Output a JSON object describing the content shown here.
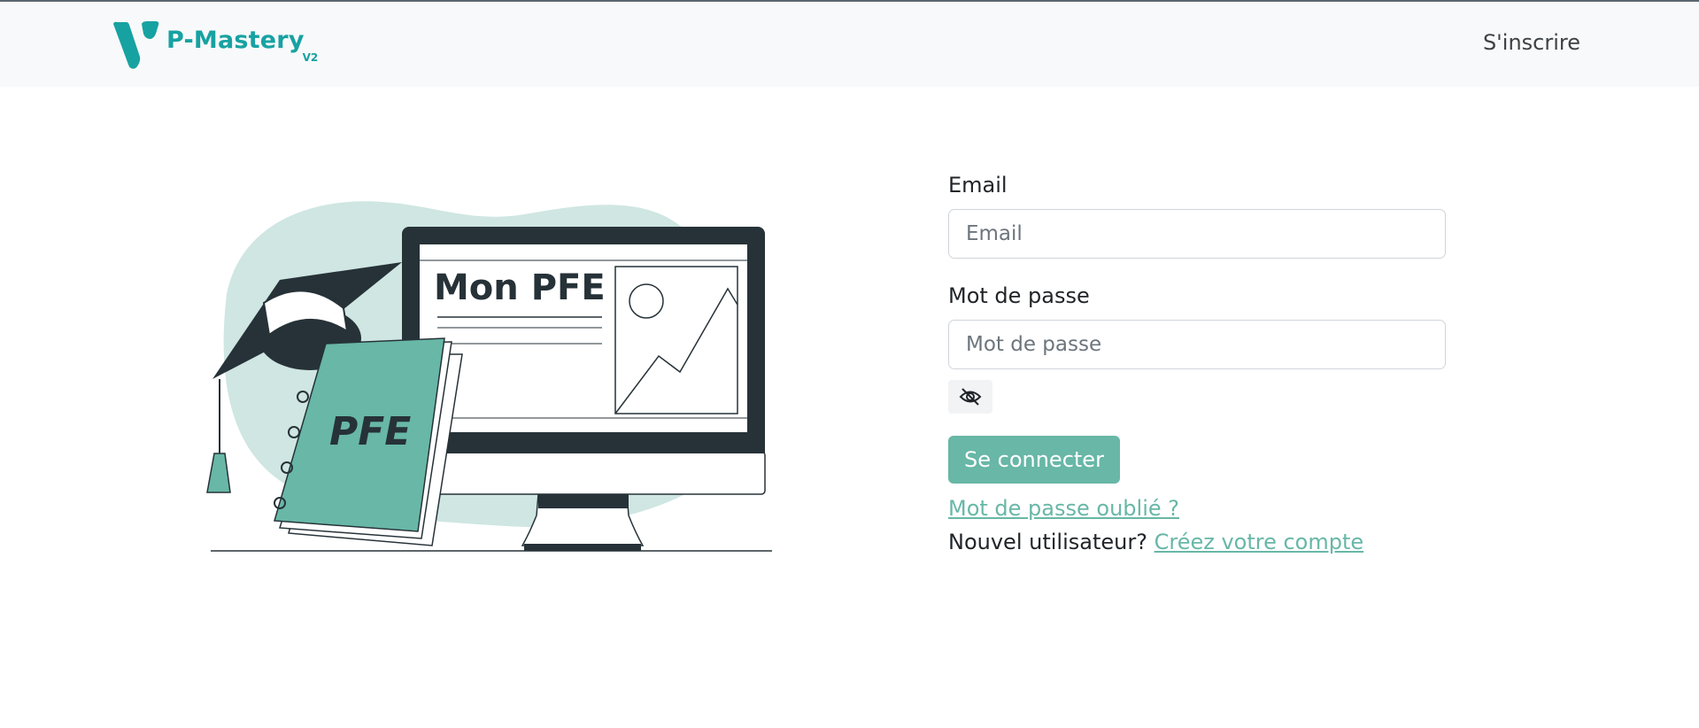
{
  "navbar": {
    "brand_name": "P-Mastery",
    "brand_version": "V2",
    "signup_label": "S'inscrire"
  },
  "illustration": {
    "monitor_title": "Mon PFE",
    "book_title": "PFE"
  },
  "form": {
    "email_label": "Email",
    "email_placeholder": "Email",
    "email_value": "",
    "password_label": "Mot de passe",
    "password_placeholder": "Mot de passe",
    "password_value": "",
    "toggle_icon": "eye-slash-icon",
    "submit_label": "Se connecter",
    "forgot_label": "Mot de passe oublié ?",
    "new_user_text": "Nouvel utilisateur?",
    "create_account_label": "Créez votre compte"
  },
  "colors": {
    "brand": "#17a2a2",
    "accent": "#68b7a7",
    "navbar_bg": "#f8f9fa",
    "dark": "#263238"
  }
}
